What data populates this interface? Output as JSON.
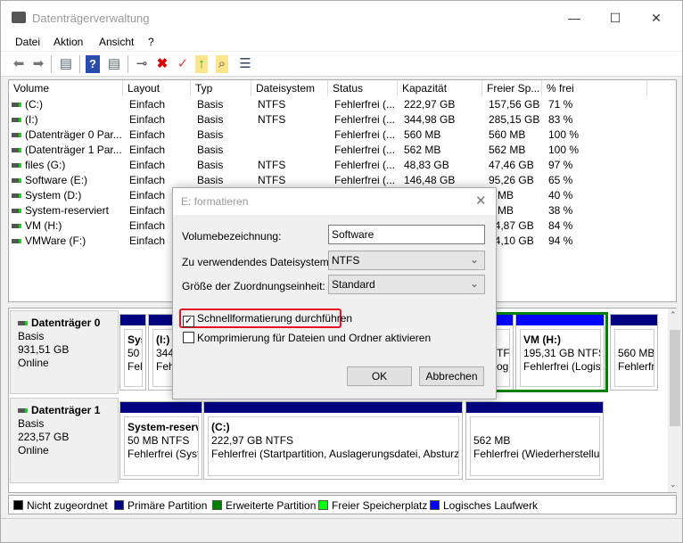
{
  "window": {
    "title": "Datenträgerverwaltung",
    "minimize": "—",
    "maximize": "☐",
    "close": "✕"
  },
  "menu": [
    "Datei",
    "Aktion",
    "Ansicht",
    "?"
  ],
  "toolbar": [
    "back-icon",
    "forward-icon",
    "console-tree-icon",
    "help-icon",
    "action-pane-icon",
    "connect-drive-icon",
    "delete-icon",
    "check-icon",
    "folder-up-icon",
    "folder-search-icon",
    "properties-list-icon"
  ],
  "columns": [
    "Volume",
    "Layout",
    "Typ",
    "Dateisystem",
    "Status",
    "Kapazität",
    "Freier Sp...",
    "% frei"
  ],
  "volumes": [
    [
      "(C:)",
      "Einfach",
      "Basis",
      "NTFS",
      "Fehlerfrei (...",
      "222,97 GB",
      "157,56 GB",
      "71 %"
    ],
    [
      "(I:)",
      "Einfach",
      "Basis",
      "NTFS",
      "Fehlerfrei (...",
      "344,98 GB",
      "285,15 GB",
      "83 %"
    ],
    [
      "(Datenträger 0 Par...",
      "Einfach",
      "Basis",
      "",
      "Fehlerfrei (...",
      "560 MB",
      "560 MB",
      "100 %"
    ],
    [
      "(Datenträger 1 Par...",
      "Einfach",
      "Basis",
      "",
      "Fehlerfrei (...",
      "562 MB",
      "562 MB",
      "100 %"
    ],
    [
      "files (G:)",
      "Einfach",
      "Basis",
      "NTFS",
      "Fehlerfrei (...",
      "48,83 GB",
      "47,46 GB",
      "97 %"
    ],
    [
      "Software (E:)",
      "Einfach",
      "Basis",
      "NTFS",
      "Fehlerfrei (...",
      "146,48 GB",
      "95,26 GB",
      "65 %"
    ],
    [
      "System (D:)",
      "Einfach",
      "",
      "",
      "",
      "",
      "0 MB",
      "40 %"
    ],
    [
      "System-reserviert",
      "Einfach",
      "",
      "",
      "",
      "",
      "9 MB",
      "38 %"
    ],
    [
      "VM (H:)",
      "Einfach",
      "",
      "",
      "",
      "",
      "54,87 GB",
      "84 %"
    ],
    [
      "VMWare (F:)",
      "Einfach",
      "",
      "",
      "",
      "",
      "34,10 GB",
      "94 %"
    ]
  ],
  "disks": [
    {
      "name": "Datenträger 0",
      "type": "Basis",
      "size": "931,51 GB",
      "state": "Online",
      "partitions": [
        {
          "l1": "Sys",
          "l2": "50 I",
          "l3": "Fehl"
        },
        {
          "l1": "(I:)",
          "l2": "344,",
          "l3": "Feh"
        },
        {
          "l1": "",
          "l2": "TFS",
          "l3": "og"
        },
        {
          "l1": "VM  (H:)",
          "l2": "195,31 GB NTFS",
          "l3": "Fehlerfrei (Logis"
        },
        {
          "l1": "",
          "l2": "560 MB",
          "l3": "Fehlerfr"
        }
      ]
    },
    {
      "name": "Datenträger 1",
      "type": "Basis",
      "size": "223,57 GB",
      "state": "Online",
      "partitions": [
        {
          "l1": "System-reserv",
          "l2": "50 MB NTFS",
          "l3": "Fehlerfrei (Syst"
        },
        {
          "l1": "(C:)",
          "l2": "222,97 GB NTFS",
          "l3": "Fehlerfrei (Startpartition, Auslagerungsdatei, Absturza"
        },
        {
          "l1": "",
          "l2": "562 MB",
          "l3": "Fehlerfrei (Wiederherstellu"
        }
      ]
    }
  ],
  "legend": [
    {
      "label": "Nicht zugeordnet",
      "color": "#000000"
    },
    {
      "label": "Primäre Partition",
      "color": "#000080"
    },
    {
      "label": "Erweiterte Partition",
      "color": "#008000"
    },
    {
      "label": "Freier Speicherplatz",
      "color": "#00ff00"
    },
    {
      "label": "Logisches Laufwerk",
      "color": "#0000ff"
    }
  ],
  "dialog": {
    "title": "E: formatieren",
    "volume_label": "Volumebezeichnung:",
    "volume_value": "Software",
    "fs_label": "Zu verwendendes Dateisystem:",
    "fs_value": "NTFS",
    "alloc_label": "Größe der Zuordnungseinheit:",
    "alloc_value": "Standard",
    "quick_format": "Schnellformatierung durchführen",
    "quick_checked": true,
    "compress": "Komprimierung für Dateien und Ordner aktivieren",
    "compress_checked": false,
    "ok": "OK",
    "cancel": "Abbrechen",
    "highlight_color": "#e81123"
  }
}
